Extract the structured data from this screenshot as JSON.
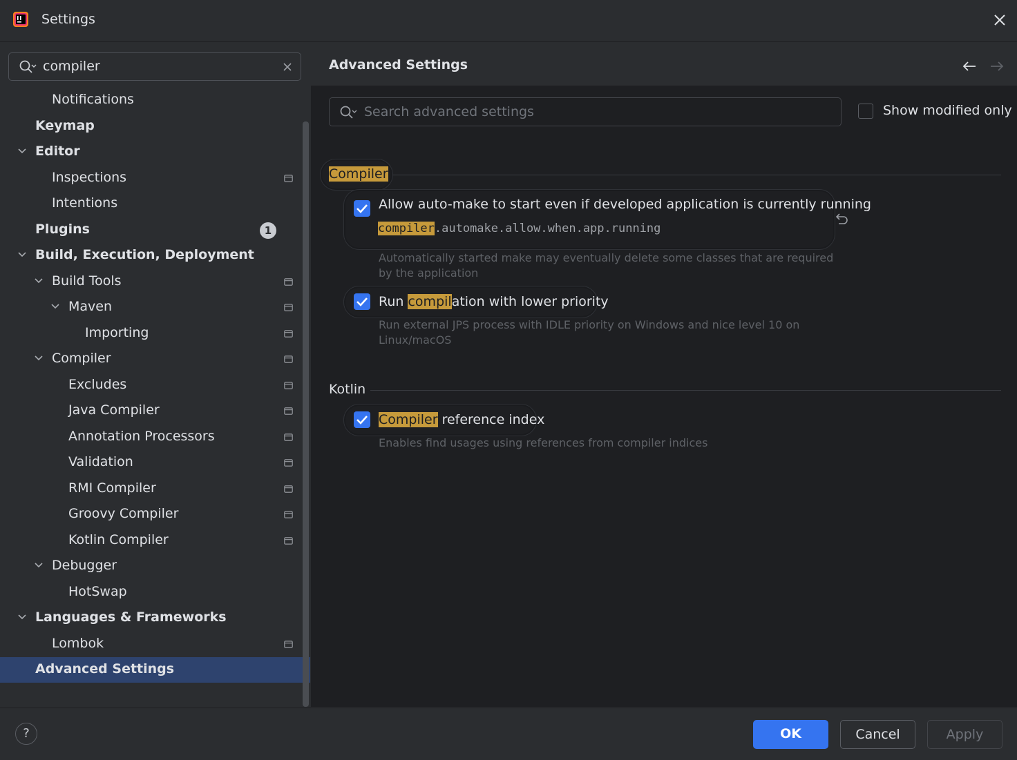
{
  "window": {
    "title": "Settings"
  },
  "search": {
    "value": "compiler"
  },
  "tree": [
    {
      "label": "Notifications",
      "indent": 2,
      "bold": false,
      "chevron": false,
      "page": false
    },
    {
      "label": "Keymap",
      "indent": 1,
      "bold": true,
      "chevron": false,
      "page": false
    },
    {
      "label": "Editor",
      "indent": 1,
      "bold": true,
      "chevron": true,
      "page": false
    },
    {
      "label": "Inspections",
      "indent": 2,
      "bold": false,
      "chevron": false,
      "page": true
    },
    {
      "label": "Intentions",
      "indent": 2,
      "bold": false,
      "chevron": false,
      "page": false
    },
    {
      "label": "Plugins",
      "indent": 1,
      "bold": true,
      "chevron": false,
      "page": false,
      "badge": "1"
    },
    {
      "label": "Build, Execution, Deployment",
      "indent": 1,
      "bold": true,
      "chevron": true,
      "page": false
    },
    {
      "label": "Build Tools",
      "indent": 2,
      "bold": false,
      "chevron": true,
      "page": true
    },
    {
      "label": "Maven",
      "indent": 3,
      "bold": false,
      "chevron": true,
      "page": true
    },
    {
      "label": "Importing",
      "indent": 4,
      "bold": false,
      "chevron": false,
      "page": true
    },
    {
      "label": "Compiler",
      "indent": 2,
      "bold": false,
      "chevron": true,
      "page": true
    },
    {
      "label": "Excludes",
      "indent": 3,
      "bold": false,
      "chevron": false,
      "page": true
    },
    {
      "label": "Java Compiler",
      "indent": 3,
      "bold": false,
      "chevron": false,
      "page": true
    },
    {
      "label": "Annotation Processors",
      "indent": 3,
      "bold": false,
      "chevron": false,
      "page": true
    },
    {
      "label": "Validation",
      "indent": 3,
      "bold": false,
      "chevron": false,
      "page": true
    },
    {
      "label": "RMI Compiler",
      "indent": 3,
      "bold": false,
      "chevron": false,
      "page": true
    },
    {
      "label": "Groovy Compiler",
      "indent": 3,
      "bold": false,
      "chevron": false,
      "page": true
    },
    {
      "label": "Kotlin Compiler",
      "indent": 3,
      "bold": false,
      "chevron": false,
      "page": true
    },
    {
      "label": "Debugger",
      "indent": 2,
      "bold": false,
      "chevron": true,
      "page": false
    },
    {
      "label": "HotSwap",
      "indent": 3,
      "bold": false,
      "chevron": false,
      "page": false
    },
    {
      "label": "Languages & Frameworks",
      "indent": 1,
      "bold": true,
      "chevron": true,
      "page": false
    },
    {
      "label": "Lombok",
      "indent": 2,
      "bold": false,
      "chevron": false,
      "page": true
    },
    {
      "label": "Advanced Settings",
      "indent": 1,
      "bold": true,
      "chevron": false,
      "page": false,
      "selected": true
    }
  ],
  "main": {
    "title": "Advanced Settings",
    "search_placeholder": "Search advanced settings",
    "show_modified_label": "Show modified only",
    "compiler_group": "Compiler",
    "kotlin_group": "Kotlin",
    "opt1": {
      "label": "Allow auto-make to start even if developed application is currently running",
      "key_hl": "compiler",
      "key_rest": ".automake.allow.when.app.running",
      "desc_line1": "Automatically started make may eventually delete some classes that are required",
      "desc_line2": "by the application"
    },
    "opt2": {
      "pre": "Run ",
      "hl": "compil",
      "post": "ation with lower priority",
      "desc_line1": "Run external JPS process with IDLE priority on Windows and nice level 10 on",
      "desc_line2": "Linux/macOS"
    },
    "opt3": {
      "hl": "Compiler",
      "post": " reference index",
      "desc": "Enables find usages using references from compiler indices"
    }
  },
  "footer": {
    "help": "?",
    "ok": "OK",
    "cancel": "Cancel",
    "apply": "Apply"
  },
  "colors": {
    "accent": "#3574f0",
    "highlight": "#c69a3b",
    "selection": "#2e436e"
  }
}
